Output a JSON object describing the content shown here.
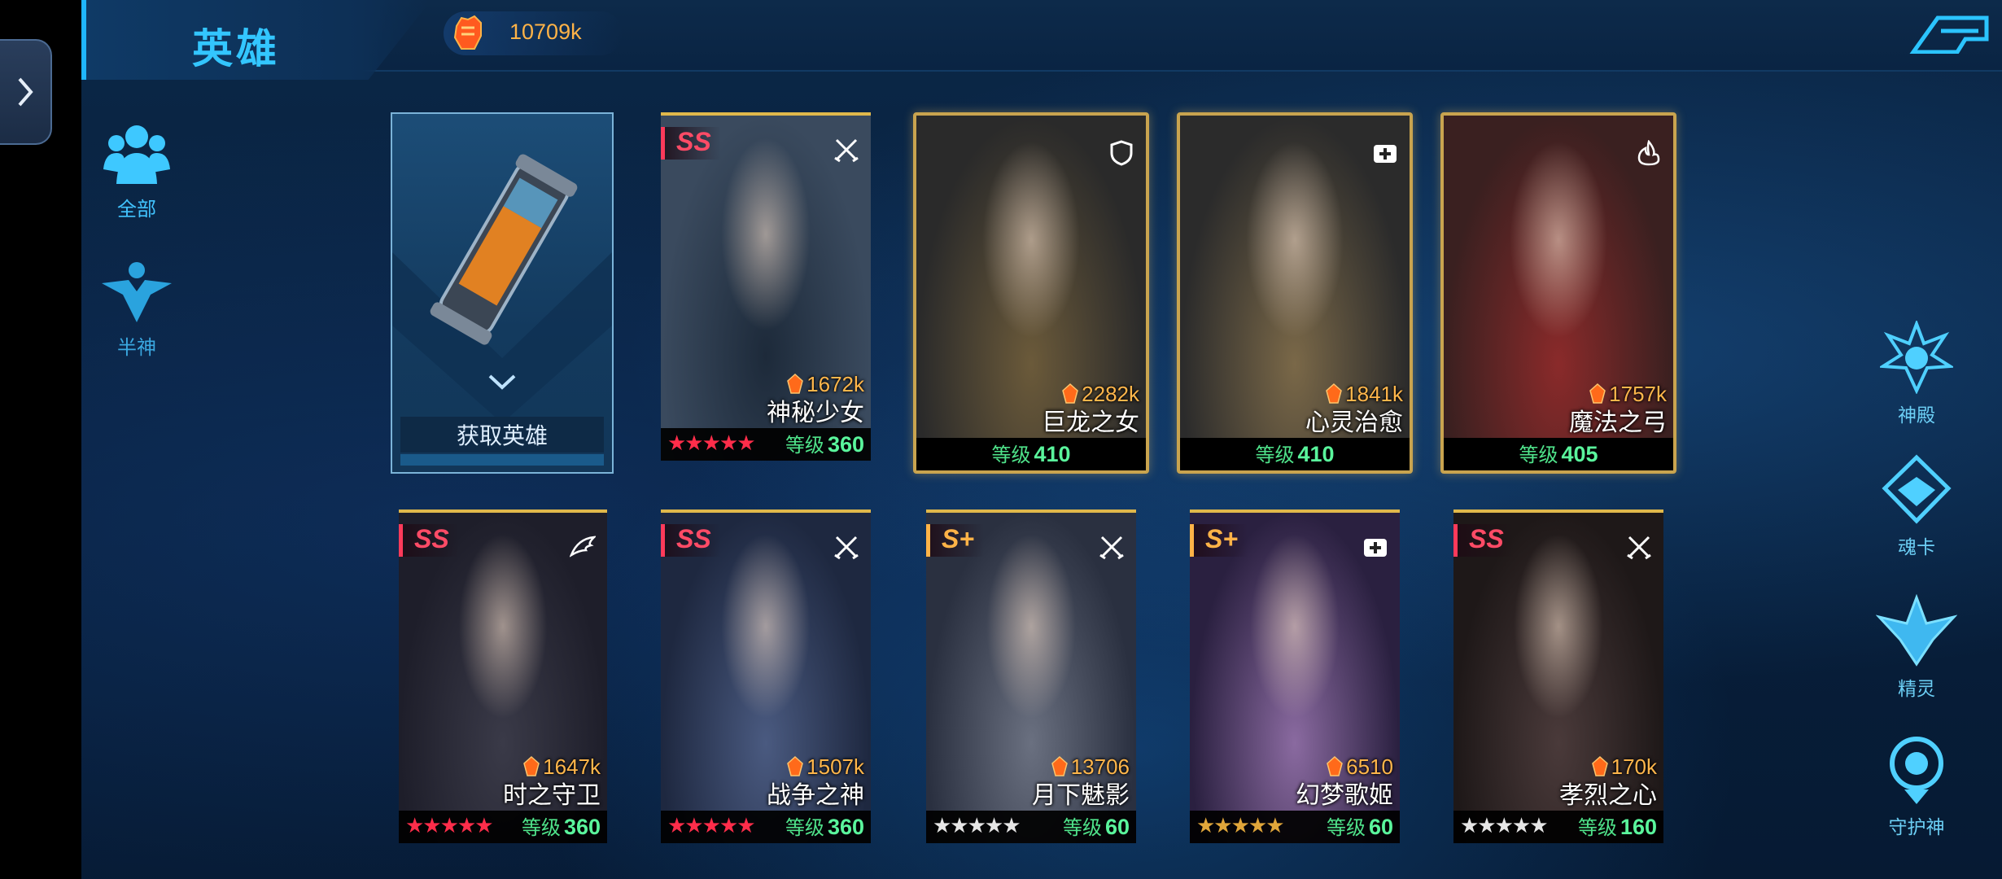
{
  "header": {
    "title": "英雄",
    "power_value": "10709k"
  },
  "categories": [
    {
      "label": "全部",
      "active": true
    },
    {
      "label": "半神",
      "active": false
    }
  ],
  "right_nav": [
    {
      "label": "神殿",
      "icon": "temple-icon"
    },
    {
      "label": "魂卡",
      "icon": "soul-card-icon"
    },
    {
      "label": "精灵",
      "icon": "spirit-icon"
    },
    {
      "label": "守护神",
      "icon": "guardian-icon"
    }
  ],
  "acquire_card": {
    "label": "获取英雄"
  },
  "level_label": "等级",
  "heroes": [
    {
      "name": "神秘少女",
      "power": "1672k",
      "level": "360",
      "rank": "SS",
      "role": "swords-icon",
      "stars": "★★★★★",
      "star_color": "#ff2d4a",
      "frame": "normal"
    },
    {
      "name": "巨龙之女",
      "power": "2282k",
      "level": "410",
      "rank": "",
      "role": "shield-icon",
      "stars": "",
      "star_color": "",
      "frame": "gold"
    },
    {
      "name": "心灵治愈",
      "power": "1841k",
      "level": "410",
      "rank": "",
      "role": "heal-icon",
      "stars": "",
      "star_color": "",
      "frame": "gold"
    },
    {
      "name": "魔法之弓",
      "power": "1757k",
      "level": "405",
      "rank": "",
      "role": "fire-icon",
      "stars": "",
      "star_color": "",
      "frame": "gold"
    },
    {
      "name": "时之守卫",
      "power": "1647k",
      "level": "360",
      "rank": "SS",
      "role": "wing-icon",
      "stars": "★★★★★",
      "star_color": "#ff2d4a",
      "frame": "normal"
    },
    {
      "name": "战争之神",
      "power": "1507k",
      "level": "360",
      "rank": "SS",
      "role": "swords-icon",
      "stars": "★★★★★",
      "star_color": "#ff2d4a",
      "frame": "normal"
    },
    {
      "name": "月下魅影",
      "power": "13706",
      "level": "60",
      "rank": "S+",
      "role": "swords-icon",
      "stars": "★★★★★",
      "star_color": "#e6e6e6",
      "frame": "normal"
    },
    {
      "name": "幻梦歌姬",
      "power": "6510",
      "level": "60",
      "rank": "S+",
      "role": "heal-icon",
      "stars": "★★★★★",
      "star_color": "#e0a63a",
      "frame": "normal"
    },
    {
      "name": "孝烈之心",
      "power": "170k",
      "level": "160",
      "rank": "SS",
      "role": "swords-icon",
      "stars": "★★★★★",
      "star_color": "#e6e6e6",
      "frame": "normal"
    }
  ],
  "colors": {
    "accent": "#33c6ff",
    "power": "#ffb64b",
    "level": "#5af59c",
    "rank_ss": "#ff4b66",
    "rank_splus": "#ffb347",
    "gold_frame": "#c9a44f"
  }
}
